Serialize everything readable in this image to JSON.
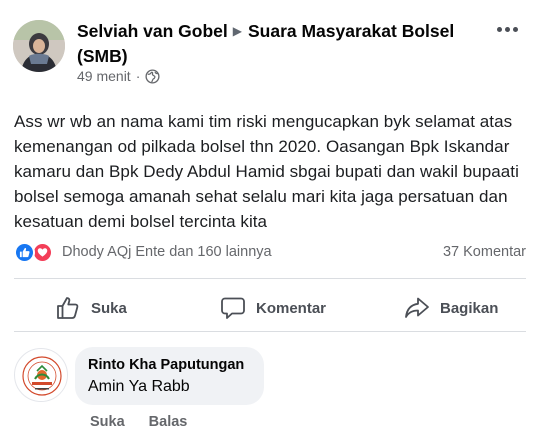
{
  "post": {
    "author": "Selviah van Gobel",
    "group": "Suara Masyarakat Bolsel (SMB)",
    "time": "49 menit",
    "privacy_icon": "globe-icon",
    "body": "Ass wr wb an nama kami tim riski mengucapkan byk selamat atas kemenangan od pilkada bolsel thn 2020. Oasangan Bpk Iskandar kamaru dan Bpk Dedy Abdul Hamid sbgai bupati dan wakil bupaati bolsel semoga amanah sehat selalu mari kita jaga persatuan dan kesatuan demi bolsel tercinta kita"
  },
  "reactions": {
    "icons": [
      "like-icon",
      "love-icon"
    ],
    "names": "Dhody AQj Ente dan 160 lainnya",
    "comment_count": "37 Komentar"
  },
  "actions": {
    "like": "Suka",
    "comment": "Komentar",
    "share": "Bagikan"
  },
  "comment": {
    "author": "Rinto Kha Paputungan",
    "text": "Amin Ya Rabb",
    "like": "Suka",
    "reply": "Balas"
  },
  "colors": {
    "like_blue": "#1877f2",
    "love_red": "#f33e58",
    "bubble_bg": "#f0f2f5",
    "muted_text": "#65676b"
  }
}
